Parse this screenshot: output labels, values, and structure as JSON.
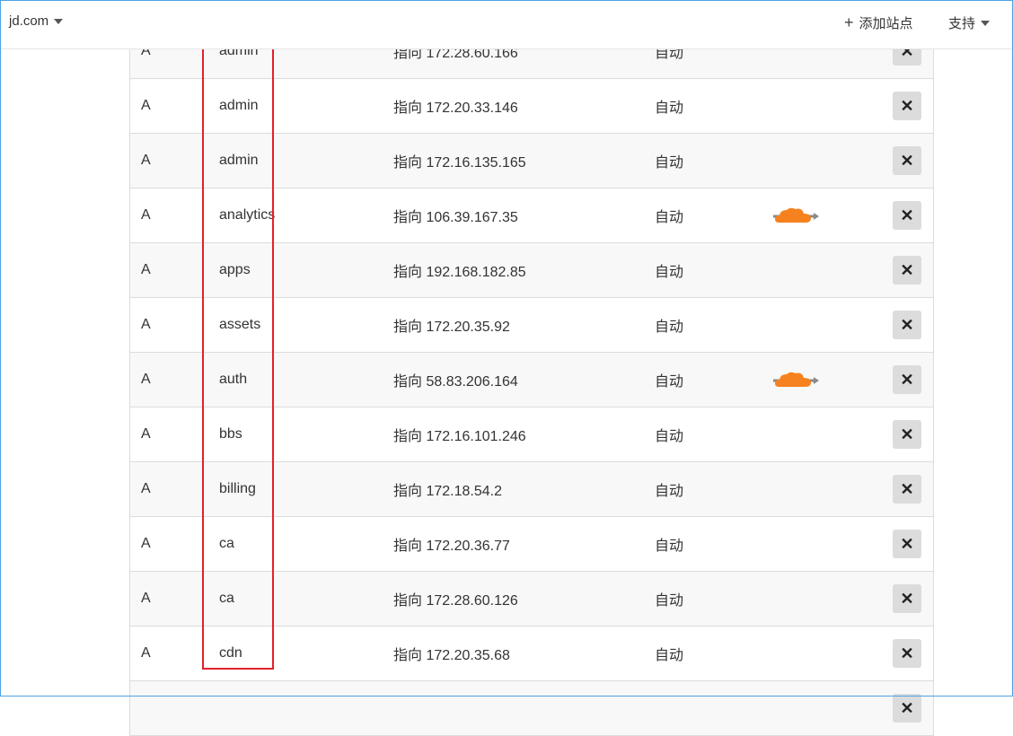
{
  "header": {
    "site": "jd.com",
    "add_site": "添加站点",
    "support": "支持"
  },
  "records": [
    {
      "type": "A",
      "name": "admin",
      "value": "指向 172.28.60.166",
      "ttl": "自动",
      "proxied": false
    },
    {
      "type": "A",
      "name": "admin",
      "value": "指向 172.20.33.146",
      "ttl": "自动",
      "proxied": false
    },
    {
      "type": "A",
      "name": "admin",
      "value": "指向 172.16.135.165",
      "ttl": "自动",
      "proxied": false
    },
    {
      "type": "A",
      "name": "analytics",
      "value": "指向 106.39.167.35",
      "ttl": "自动",
      "proxied": true
    },
    {
      "type": "A",
      "name": "apps",
      "value": "指向 192.168.182.85",
      "ttl": "自动",
      "proxied": false
    },
    {
      "type": "A",
      "name": "assets",
      "value": "指向 172.20.35.92",
      "ttl": "自动",
      "proxied": false
    },
    {
      "type": "A",
      "name": "auth",
      "value": "指向 58.83.206.164",
      "ttl": "自动",
      "proxied": true
    },
    {
      "type": "A",
      "name": "bbs",
      "value": "指向 172.16.101.246",
      "ttl": "自动",
      "proxied": false
    },
    {
      "type": "A",
      "name": "billing",
      "value": "指向 172.18.54.2",
      "ttl": "自动",
      "proxied": false
    },
    {
      "type": "A",
      "name": "ca",
      "value": "指向 172.20.36.77",
      "ttl": "自动",
      "proxied": false
    },
    {
      "type": "A",
      "name": "ca",
      "value": "指向 172.28.60.126",
      "ttl": "自动",
      "proxied": false
    },
    {
      "type": "A",
      "name": "cdn",
      "value": "指向 172.20.35.68",
      "ttl": "自动",
      "proxied": false
    },
    {
      "type": "",
      "name": "",
      "value": "",
      "ttl": "",
      "proxied": false
    }
  ],
  "colors": {
    "cloud": "#f6821f",
    "highlight": "#e3202b",
    "arrow": "#8a8a8a"
  }
}
